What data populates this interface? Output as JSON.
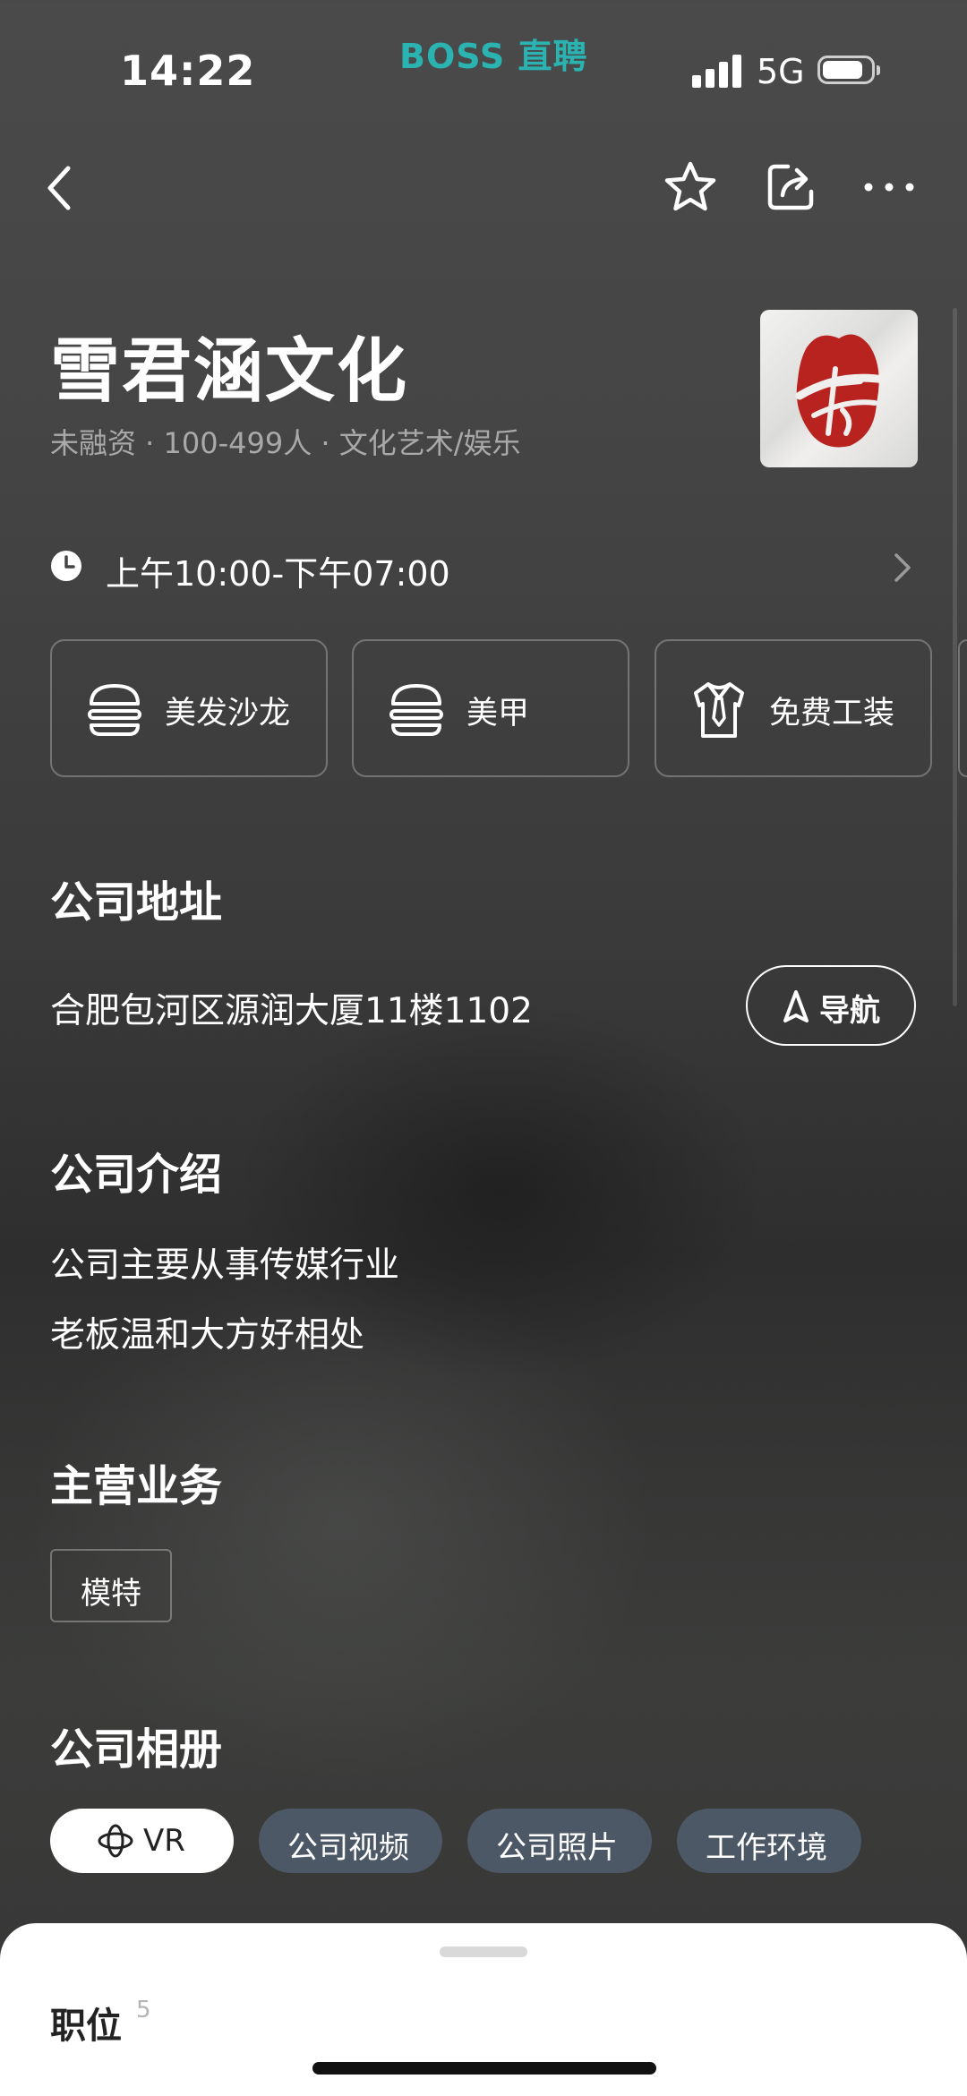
{
  "status_bar": {
    "time": "14:22",
    "app_logo": "BOSS 直聘",
    "network": "5G",
    "battery_level": 0.8
  },
  "nav": {
    "back_icon": "chevron-left-icon",
    "favorite_icon": "star-icon",
    "share_icon": "share-icon",
    "more_icon": "more-dots-icon"
  },
  "company": {
    "name": "雪君涵文化",
    "meta": "未融资 · 100-499人 · 文化艺术/娱乐",
    "logo_icon": "company-logo"
  },
  "hours": {
    "text": "上午10:00-下午07:00"
  },
  "benefits": [
    {
      "label": "美发沙龙",
      "icon": "burger-icon"
    },
    {
      "label": "美甲",
      "icon": "burger-icon"
    },
    {
      "label": "免费工装",
      "icon": "uniform-icon"
    }
  ],
  "address_section": {
    "title": "公司地址",
    "address": "合肥包河区源润大厦11楼1102",
    "nav_button": "导航"
  },
  "intro_section": {
    "title": "公司介绍",
    "lines": [
      "公司主要从事传媒行业",
      "老板温和大方好相处"
    ]
  },
  "business_section": {
    "title": "主营业务",
    "tags": [
      "模特"
    ]
  },
  "album_section": {
    "title": "公司相册",
    "tabs": [
      "VR",
      "公司视频",
      "公司照片",
      "工作环境"
    ]
  },
  "jobs_sheet": {
    "title": "职位",
    "count": "5"
  },
  "colors": {
    "brand": "#2bb3b1",
    "logo_red": "#b8221f",
    "tab_muted": "#4d5866"
  }
}
